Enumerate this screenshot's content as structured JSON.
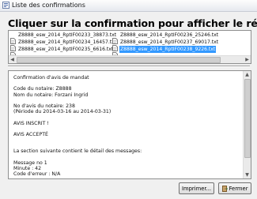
{
  "window": {
    "title": "Liste des confirmations"
  },
  "heading": "Cliquer sur la confirmation pour afficher le résultat",
  "files": [
    {
      "name": "Z8888_esw_2014_RptIF00233_38873.txt",
      "selected": false
    },
    {
      "name": "Z8888_esw_2014_RptIF00234_16457.txt",
      "selected": false
    },
    {
      "name": "Z8888_esw_2014_RptIF00235_6616.txt",
      "selected": false
    },
    {
      "name": "Z8888_esw_2014_RptIF00236_25246.txt",
      "selected": false
    },
    {
      "name": "Z8888_esw_2014_RptIF00237_69017.txt",
      "selected": false
    },
    {
      "name": "Z8888_esw_2014_RptIF00238_9226.txt",
      "selected": true
    }
  ],
  "result_lines": [
    "Confirmation d'avis de mandat",
    "",
    "Code du notaire: Z8888",
    "Nom du notaire: Forzani Ingrid",
    "",
    "No d'avis du notaire: 238",
    "  (Période du 2014-03-16 au 2014-03-31)",
    "",
    "AVIS INSCRIT !",
    "",
    "AVIS ACCEPTÉ",
    "",
    "",
    "La section suivante contient le détail des messages:",
    "",
    "Message no 1",
    "Minute : 42",
    "Code d'erreur : N/A"
  ],
  "buttons": {
    "print": "Imprimer...",
    "close": "Fermer"
  }
}
